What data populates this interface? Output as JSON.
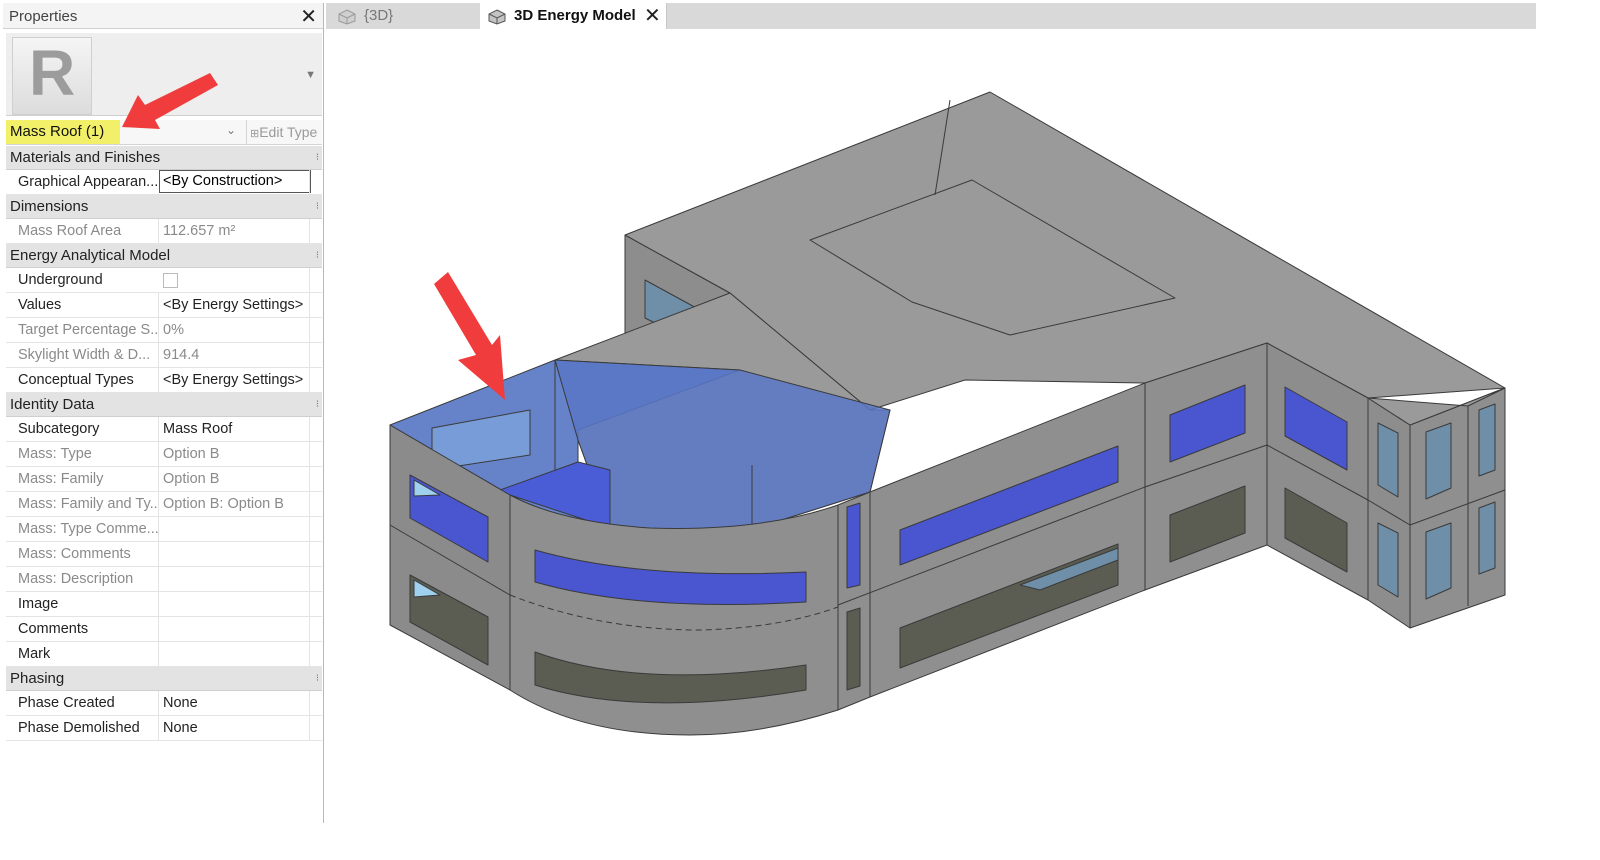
{
  "properties": {
    "title": "Properties",
    "selector_label": "Mass Roof (1)",
    "edit_type_label": "Edit Type",
    "sections": [
      {
        "label": "Materials and Finishes",
        "rows": [
          {
            "key": "Graphical Appearan...",
            "value": "<By Construction>",
            "style": "box"
          }
        ]
      },
      {
        "label": "Dimensions",
        "rows": [
          {
            "key": "Mass Roof Area",
            "value": "112.657 m²",
            "style": "gray"
          }
        ]
      },
      {
        "label": "Energy Analytical Model",
        "rows": [
          {
            "key": "Underground",
            "value": "",
            "style": "checkbox"
          },
          {
            "key": "Values",
            "value": "<By Energy Settings>",
            "style": "normal"
          },
          {
            "key": "Target Percentage S...",
            "value": "0%",
            "style": "gray"
          },
          {
            "key": "Skylight Width & D...",
            "value": "914.4",
            "style": "gray"
          },
          {
            "key": "Conceptual Types",
            "value": "<By Energy Settings>",
            "style": "normal"
          }
        ]
      },
      {
        "label": "Identity Data",
        "rows": [
          {
            "key": "Subcategory",
            "value": "Mass Roof",
            "style": "normal"
          },
          {
            "key": "Mass: Type",
            "value": "Option B",
            "style": "gray"
          },
          {
            "key": "Mass: Family",
            "value": "Option B",
            "style": "gray"
          },
          {
            "key": "Mass: Family and Ty...",
            "value": "Option B: Option B",
            "style": "gray"
          },
          {
            "key": "Mass: Type Comme...",
            "value": "",
            "style": "gray"
          },
          {
            "key": "Mass: Comments",
            "value": "",
            "style": "gray"
          },
          {
            "key": "Mass: Description",
            "value": "",
            "style": "gray"
          },
          {
            "key": "Image",
            "value": "",
            "style": "normal"
          },
          {
            "key": "Comments",
            "value": "",
            "style": "normal"
          },
          {
            "key": "Mark",
            "value": "",
            "style": "normal"
          }
        ]
      },
      {
        "label": "Phasing",
        "rows": [
          {
            "key": "Phase Created",
            "value": "None",
            "style": "normal"
          },
          {
            "key": "Phase Demolished",
            "value": "None",
            "style": "normal"
          }
        ]
      }
    ]
  },
  "tabs": [
    {
      "label": "{3D}",
      "active": false
    },
    {
      "label": "3D Energy Model",
      "active": true
    }
  ],
  "colors": {
    "highlight": "#f2ef68",
    "arrow": "#f03c3c",
    "wall": "#8f8f8f",
    "roof": "#999999",
    "glazing": "#4a55d0",
    "selected": "#5576c4"
  },
  "icons": {
    "close": "close-icon",
    "view_tab": "3d-view-icon",
    "app": "revit-logo"
  }
}
